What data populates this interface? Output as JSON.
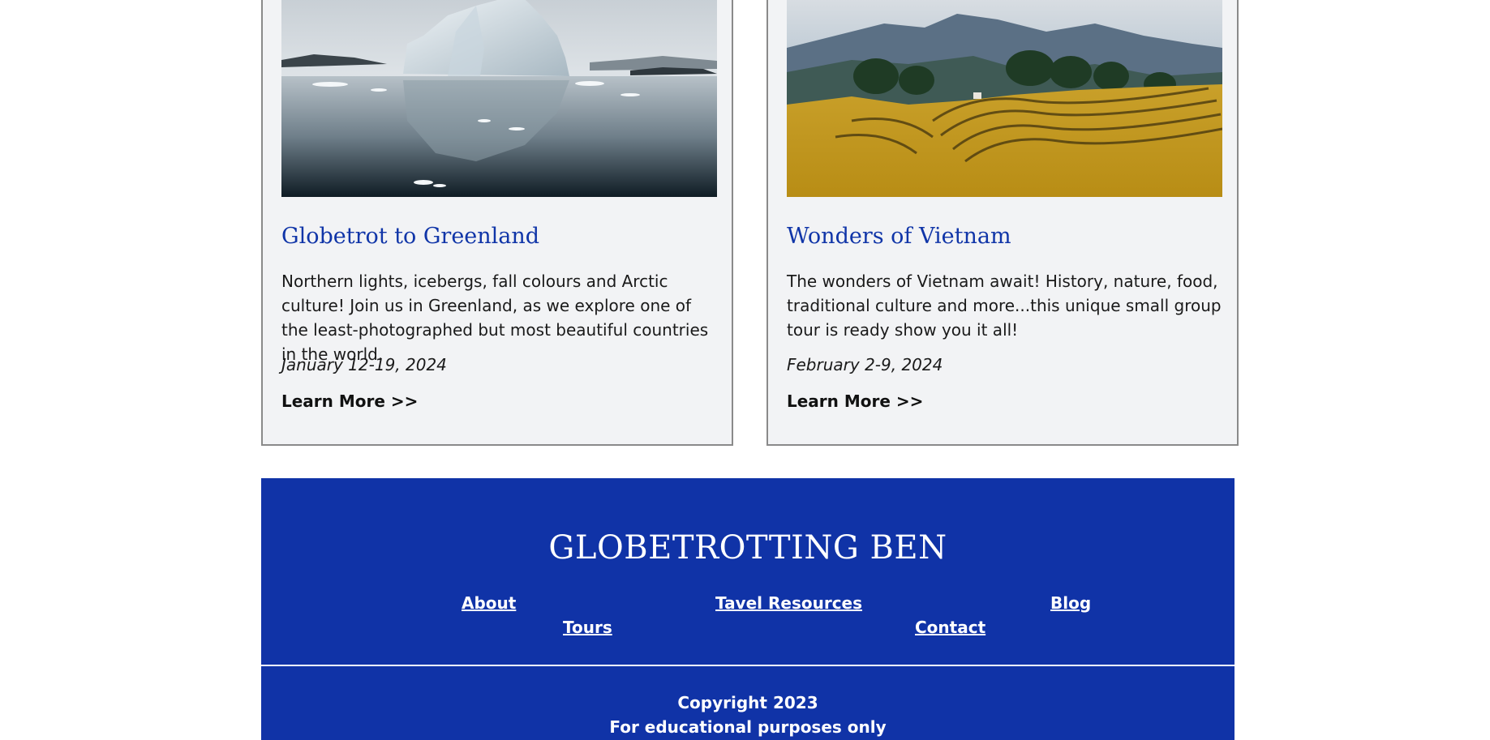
{
  "cards": [
    {
      "image_alt": "Iceberg reflected in still arctic water",
      "title": "Globetrot to Greenland",
      "description": "Northern lights, icebergs, fall colours and Arctic culture! Join us in Greenland, as we explore one of the least-photographed but most beautiful countries in the world.",
      "date": "January 12-19, 2024",
      "link_label": "Learn More >>"
    },
    {
      "image_alt": "Golden rice terraces below mountains",
      "title": "Wonders of Vietnam",
      "description": "The wonders of Vietnam await! History, nature, food, traditional culture and more...this unique small group tour is ready show you it all!",
      "date": "February 2-9, 2024",
      "link_label": "Learn More >>"
    }
  ],
  "footer": {
    "brand": "GLOBETROTTING BEN",
    "nav": {
      "about": "About",
      "travel_resources": "Tavel Resources",
      "blog": "Blog",
      "tours": "Tours",
      "contact": "Contact"
    },
    "copyright": "Copyright 2023",
    "disclaimer": "For educational purposes only"
  },
  "colors": {
    "brand_blue": "#1033a7",
    "title_blue": "#1035a8",
    "card_bg": "#f2f3f5"
  }
}
